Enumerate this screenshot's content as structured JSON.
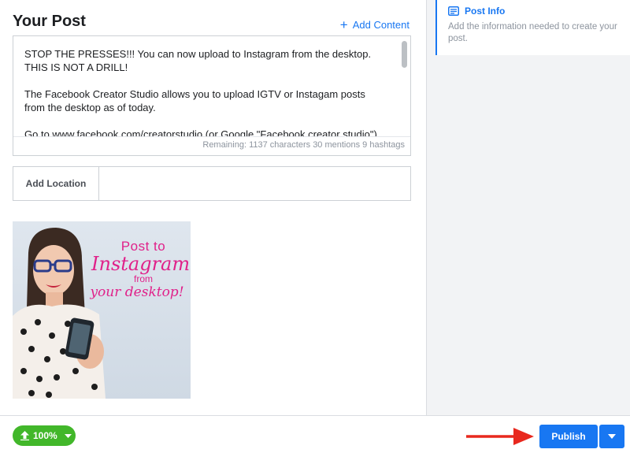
{
  "post": {
    "title": "Your Post",
    "add_content_label": "Add Content",
    "text_paragraphs": [
      "STOP THE PRESSES!!! You can now upload to Instagram from the desktop. THIS IS NOT A DRILL!",
      "The Facebook Creator Studio allows you to upload IGTV or Instagam posts from the desktop as of today.",
      "Go to www.facebook.com/creatorstudio (or Google \"Facebook creator studio\") to log"
    ],
    "remaining": "Remaining: 1137 characters 30 mentions 9 hashtags",
    "location_label": "Add Location",
    "location_value": ""
  },
  "image": {
    "line1": "Post to",
    "line2": "Instagram",
    "line3": "from",
    "line4": "your desktop!"
  },
  "side_panel": {
    "tab_label": "Post Info",
    "tab_description": "Add the information needed to create your post."
  },
  "footer": {
    "upload_percent": "100%",
    "publish_label": "Publish"
  },
  "colors": {
    "accent": "#1877f2",
    "upload_green": "#42b72a",
    "arrow_red": "#e8281e",
    "brand_pink": "#e0218a"
  }
}
